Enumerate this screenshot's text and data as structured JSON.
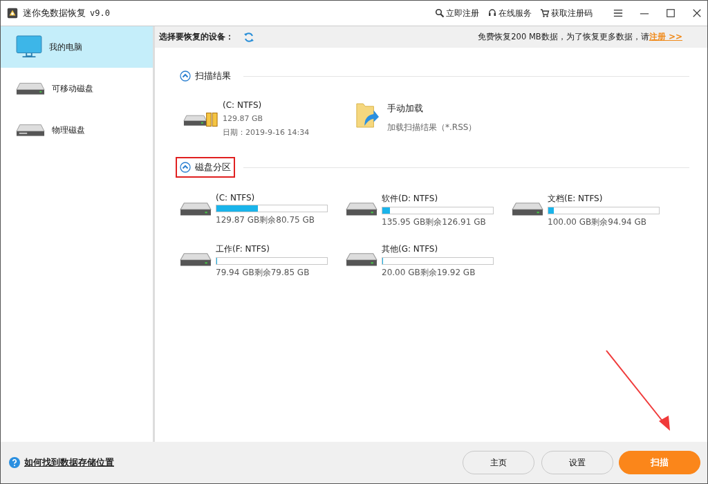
{
  "window": {
    "title": "迷你免数据恢复",
    "version": "v9.0",
    "actions": [
      {
        "kind": "register",
        "label": "立即注册"
      },
      {
        "kind": "service",
        "label": "在线服务"
      },
      {
        "kind": "buy",
        "label": "获取注册码"
      }
    ]
  },
  "sidebar": {
    "items": [
      {
        "kind": "computer",
        "label": "我的电脑",
        "selected": true
      },
      {
        "kind": "removable",
        "label": "可移动磁盘",
        "selected": false
      },
      {
        "kind": "physical",
        "label": "物理磁盘",
        "selected": false
      }
    ]
  },
  "header": {
    "label": "选择要恢复的设备：",
    "notice": "免费恢复200 MB数据，为了恢复更多数据，请",
    "link": "注册 >>"
  },
  "scan_results": {
    "title": "扫描结果",
    "highlighted": false,
    "items": [
      {
        "kind": "result",
        "name": "(C: NTFS)",
        "size": "129.87 GB",
        "date": "日期：2019-9-16 14:34"
      },
      {
        "kind": "manual",
        "name": "手动加载",
        "desc": "加载扫描结果（*.RSS）"
      }
    ]
  },
  "partitions": {
    "title": "磁盘分区",
    "highlighted": true,
    "items": [
      {
        "name": "(C: NTFS)",
        "level": 0.378,
        "info": "129.87 GB剩余80.75 GB"
      },
      {
        "name": "软件(D: NTFS)",
        "level": 0.066,
        "info": "135.95 GB剩余126.91 GB"
      },
      {
        "name": "文档(E: NTFS)",
        "level": 0.051,
        "info": "100.00 GB剩余94.94 GB"
      },
      {
        "name": "工作(F: NTFS)",
        "level": 0.001,
        "info": "79.94 GB剩余79.85 GB"
      },
      {
        "name": "其他(G: NTFS)",
        "level": 0.004,
        "info": "20.00 GB剩余19.92 GB"
      }
    ]
  },
  "footer": {
    "help": "如何找到数据存储位置",
    "buttons": [
      {
        "kind": "normal",
        "label": "主页"
      },
      {
        "kind": "normal",
        "label": "设置"
      },
      {
        "kind": "primary",
        "label": "扫描"
      }
    ]
  }
}
